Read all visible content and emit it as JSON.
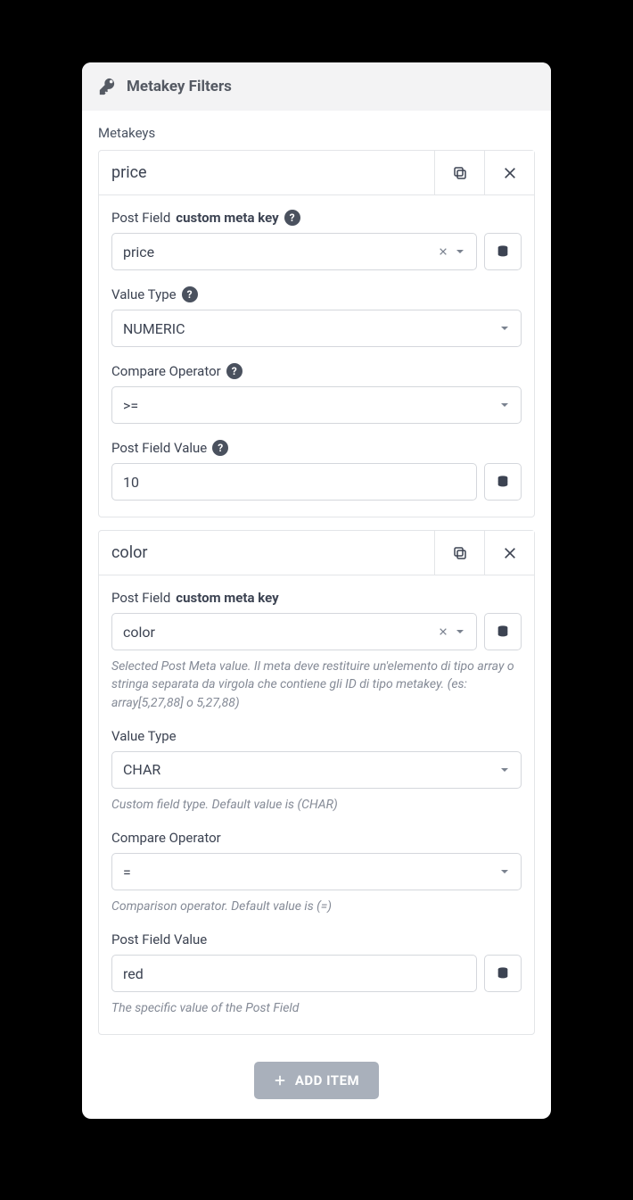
{
  "panel": {
    "title": "Metakey Filters"
  },
  "section": {
    "label": "Metakeys"
  },
  "items": [
    {
      "title": "price",
      "fields": {
        "metakey": {
          "label_prefix": "Post Field",
          "label_bold": "custom meta key",
          "has_help": true,
          "value": "price",
          "hint": ""
        },
        "value_type": {
          "label": "Value Type",
          "has_help": true,
          "value": "NUMERIC",
          "hint": ""
        },
        "compare": {
          "label": "Compare Operator",
          "has_help": true,
          "value": ">=",
          "hint": ""
        },
        "post_value": {
          "label": "Post Field Value",
          "has_help": true,
          "value": "10",
          "hint": ""
        }
      }
    },
    {
      "title": "color",
      "fields": {
        "metakey": {
          "label_prefix": "Post Field",
          "label_bold": "custom meta key",
          "has_help": false,
          "value": "color",
          "hint": "Selected Post Meta value. Il meta deve restituire un'elemento di tipo array o stringa separata da virgola che contiene gli ID di tipo metakey. (es: array[5,27,88] o 5,27,88)"
        },
        "value_type": {
          "label": "Value Type",
          "has_help": false,
          "value": "CHAR",
          "hint": "Custom field type. Default value is (CHAR)"
        },
        "compare": {
          "label": "Compare Operator",
          "has_help": false,
          "value": "=",
          "hint": "Comparison operator. Default value is (=)"
        },
        "post_value": {
          "label": "Post Field Value",
          "has_help": false,
          "value": "red",
          "hint": "The specific value of the Post Field"
        }
      }
    }
  ],
  "add_button": "ADD ITEM"
}
